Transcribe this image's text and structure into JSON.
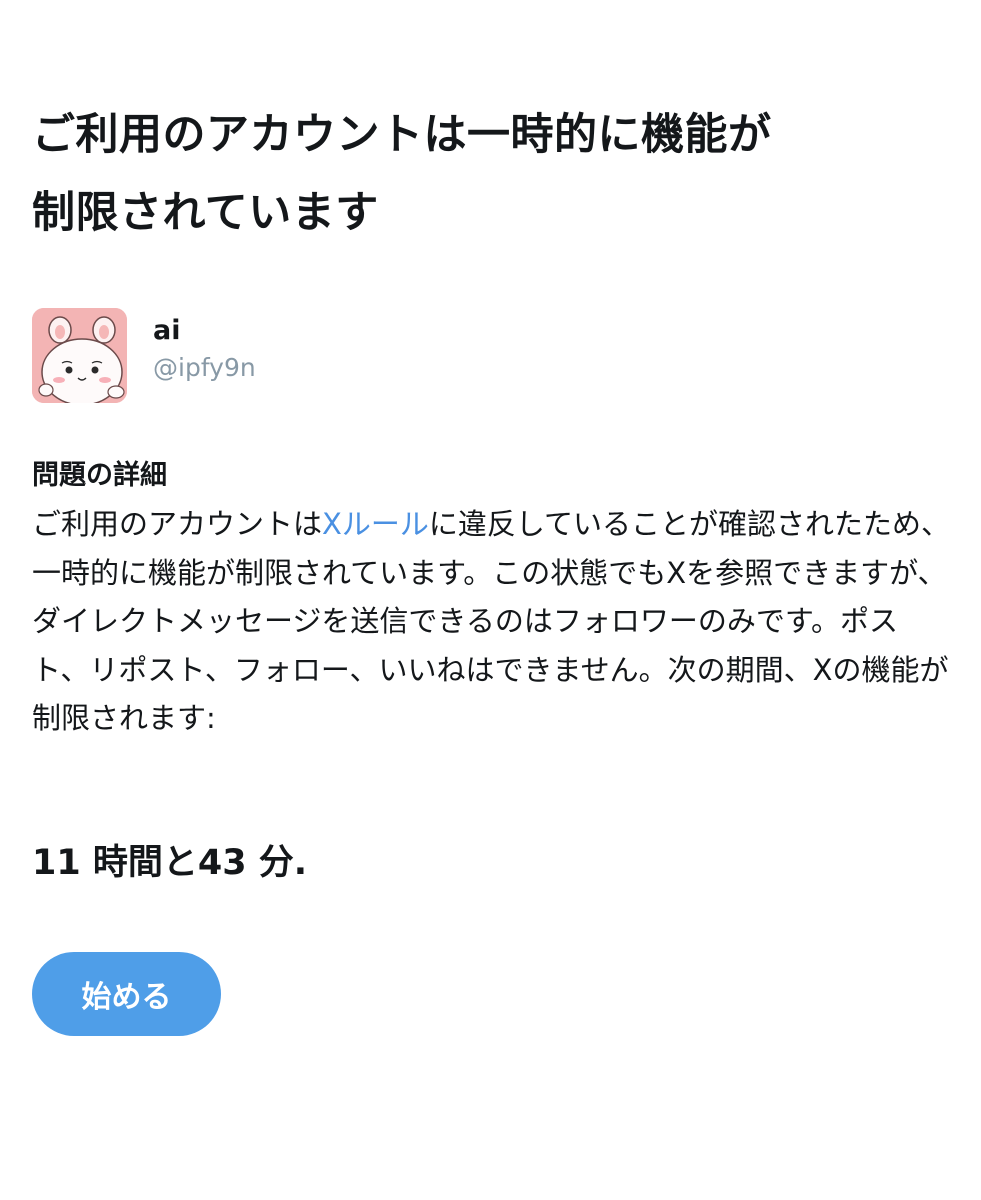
{
  "page": {
    "title_line1": "ご利用のアカウントは一時的に機能が",
    "title_line2": "制限されています"
  },
  "account": {
    "display_name": "ai",
    "handle": "@ipfy9n",
    "avatar_icon": "avatar-character-icon"
  },
  "details": {
    "heading": "問題の詳細",
    "text_before_link": "ご利用のアカウントは",
    "link_text": "Xルール",
    "text_after_link": "に違反していることが確認されたため、一時的に機能が制限されています。この状態でもXを参照できますが、ダイレクトメッセージを送信できるのはフォロワーのみです。ポスト、リポスト、フォロー、いいねはできません。次の期間、Xの機能が制限されます:"
  },
  "restriction": {
    "duration": "11 時間と43 分."
  },
  "actions": {
    "start_label": "始める"
  },
  "colors": {
    "link": "#4a90e2",
    "button": "#4f9ee8",
    "handle": "#8899a6",
    "avatar_bg": "#f3b4b4"
  }
}
